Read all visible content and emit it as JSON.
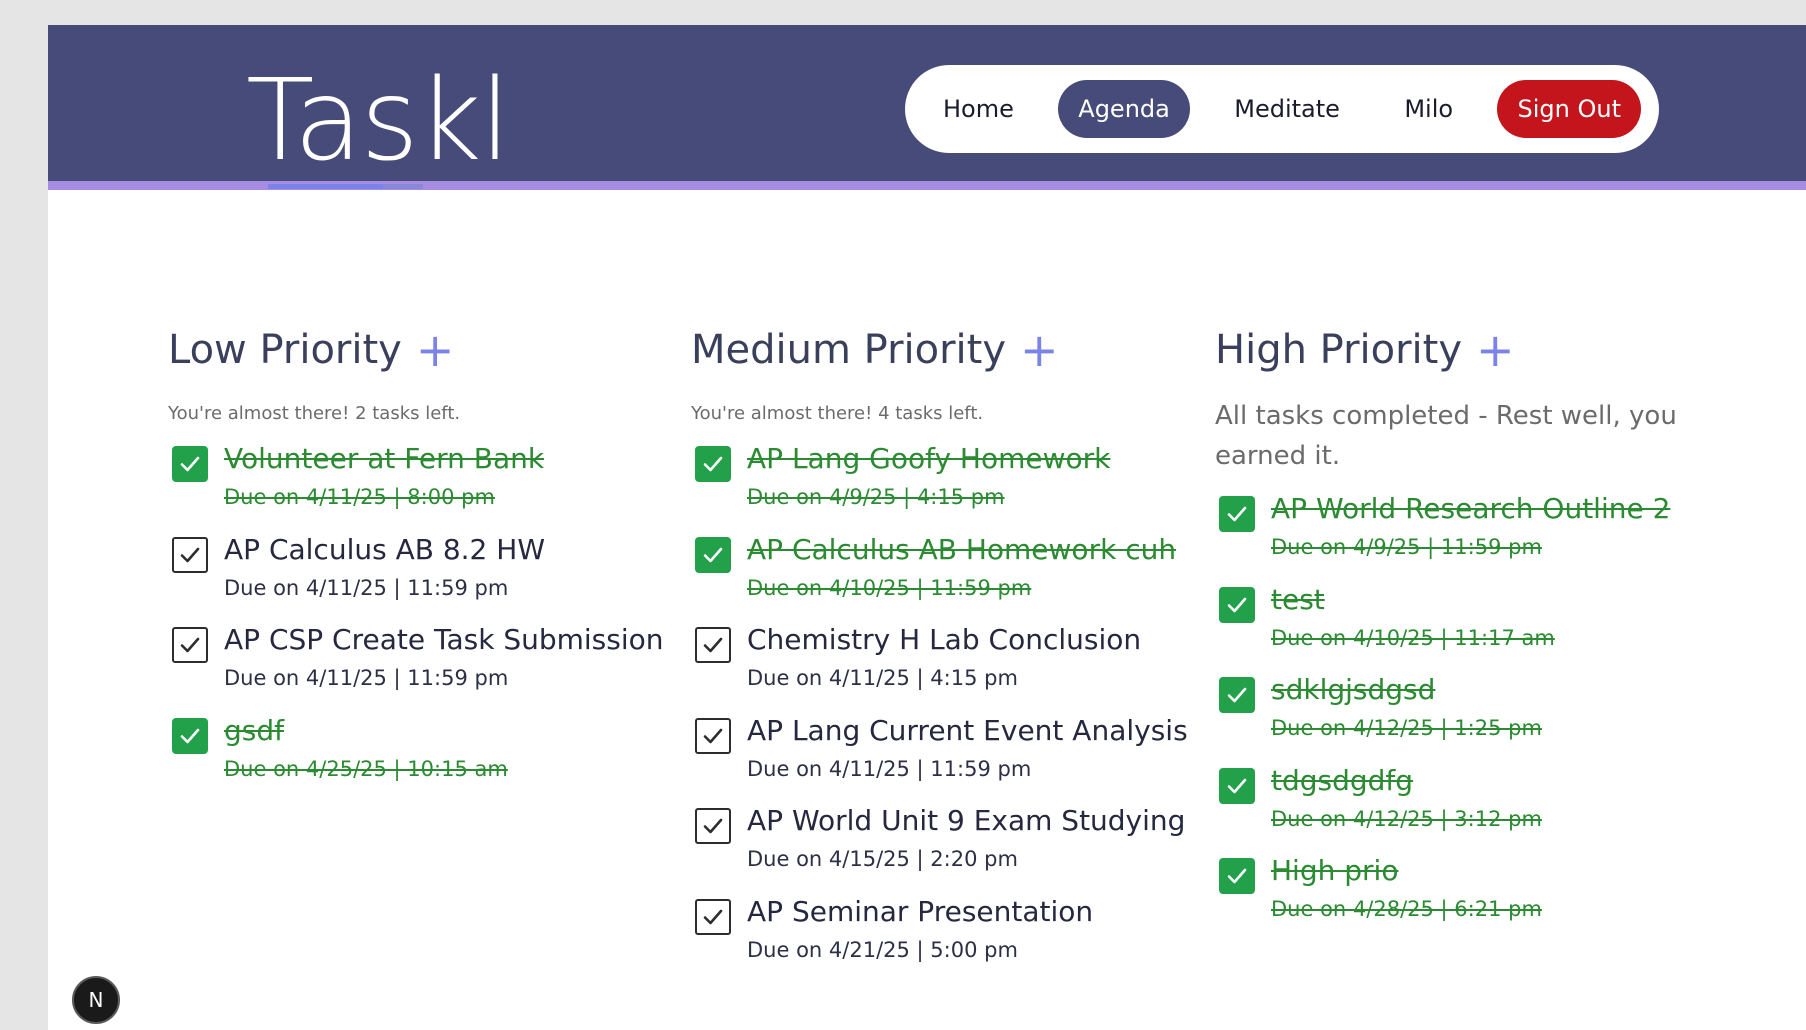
{
  "brand": {
    "logo_text": "Taskl"
  },
  "nav": {
    "items": [
      {
        "label": "Home",
        "active": false
      },
      {
        "label": "Agenda",
        "active": true
      },
      {
        "label": "Meditate",
        "active": false
      },
      {
        "label": "Milo",
        "active": false
      }
    ],
    "signout_label": "Sign Out"
  },
  "columns": [
    {
      "title": "Low Priority",
      "add_symbol": "+",
      "subtitle": "You're almost there! 2 tasks left.",
      "tasks": [
        {
          "title": "Volunteer at Fern Bank",
          "due": "Due on 4/11/25 | 8:00 pm",
          "done": true
        },
        {
          "title": "AP Calculus AB 8.2 HW",
          "due": "Due on 4/11/25 | 11:59 pm",
          "done": false
        },
        {
          "title": "AP CSP Create Task Submission",
          "due": "Due on 4/11/25 | 11:59 pm",
          "done": false
        },
        {
          "title": "gsdf",
          "due": "Due on 4/25/25 | 10:15 am",
          "done": true
        }
      ]
    },
    {
      "title": "Medium Priority",
      "add_symbol": "+",
      "subtitle": "You're almost there! 4 tasks left.",
      "tasks": [
        {
          "title": "AP Lang Goofy Homework",
          "due": "Due on 4/9/25 | 4:15 pm",
          "done": true
        },
        {
          "title": "AP Calculus AB Homework cuh",
          "due": "Due on 4/10/25 | 11:59 pm",
          "done": true
        },
        {
          "title": "Chemistry H Lab Conclusion",
          "due": "Due on 4/11/25 | 4:15 pm",
          "done": false
        },
        {
          "title": "AP Lang Current Event Analysis",
          "due": "Due on 4/11/25 | 11:59 pm",
          "done": false
        },
        {
          "title": "AP World Unit 9 Exam Studying",
          "due": "Due on 4/15/25 | 2:20 pm",
          "done": false
        },
        {
          "title": "AP Seminar Presentation",
          "due": "Due on 4/21/25 | 5:00 pm",
          "done": false
        }
      ]
    },
    {
      "title": "High Priority",
      "add_symbol": "+",
      "subtitle": "All tasks completed - Rest well, you earned it.",
      "tasks": [
        {
          "title": "AP World Research Outline 2",
          "due": "Due on 4/9/25 | 11:59 pm",
          "done": true
        },
        {
          "title": "test",
          "due": "Due on 4/10/25 | 11:17 am",
          "done": true
        },
        {
          "title": "sdklgjsdgsd",
          "due": "Due on 4/12/25 | 1:25 pm",
          "done": true
        },
        {
          "title": "tdgsdgdfg",
          "due": "Due on 4/12/25 | 3:12 pm",
          "done": true
        },
        {
          "title": "High prio",
          "due": "Due on 4/28/25 | 6:21 pm",
          "done": true
        }
      ]
    }
  ],
  "dev_badge": {
    "letter": "N"
  },
  "colors": {
    "header_bg": "#474b79",
    "header_accent": "#a68ce3",
    "checkbox_done": "#23a14a",
    "done_text": "#2b8a32",
    "plus": "#7b83e8",
    "signout": "#c4141c"
  },
  "icons": {
    "checkbox": "check-icon",
    "add": "plus-icon"
  }
}
